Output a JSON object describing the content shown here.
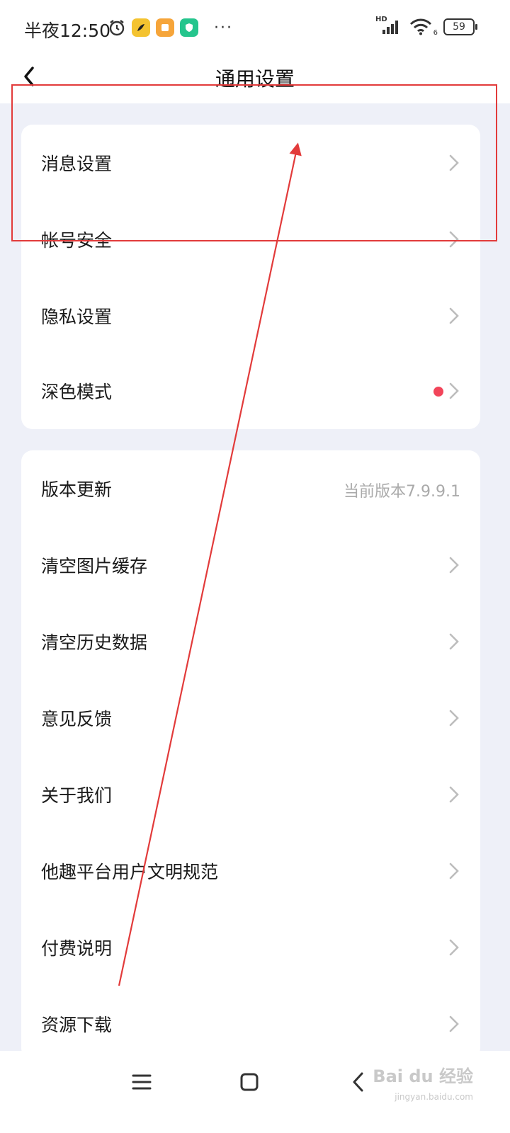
{
  "status_bar": {
    "time": "半夜12:50",
    "more": "···",
    "network": "HD",
    "signal_sub": "6",
    "battery": "59",
    "icons": [
      "alarm-icon",
      "app-yellow-icon",
      "app-orange-icon",
      "app-green-shield-icon",
      "signal-icon",
      "wifi-icon",
      "battery-icon"
    ]
  },
  "header": {
    "title": "通用设置",
    "back_icon": "chevron-left-icon"
  },
  "section1": {
    "items": [
      {
        "label": "消息设置"
      },
      {
        "label": "帐号安全"
      },
      {
        "label": "隐私设置"
      },
      {
        "label": "深色模式",
        "badge": "red-dot"
      }
    ]
  },
  "section2": {
    "items": [
      {
        "label": "版本更新",
        "value": "当前版本7.9.9.1"
      },
      {
        "label": "清空图片缓存"
      },
      {
        "label": "清空历史数据"
      },
      {
        "label": "意见反馈"
      },
      {
        "label": "关于我们"
      },
      {
        "label": "他趣平台用户文明规范"
      },
      {
        "label": "付费说明"
      },
      {
        "label": "资源下载"
      }
    ]
  },
  "nav_bar": {
    "icons": [
      "menu-icon",
      "home-square-icon",
      "back-chevron-icon"
    ]
  },
  "watermark": {
    "text": "Bai du 经验",
    "sub": "jingyan.baidu.com"
  },
  "colors": {
    "background": "#eef0f8",
    "card": "#ffffff",
    "annotation": "#e23b3b",
    "badge_red": "#f2455a",
    "muted_text": "#aaaaaa"
  }
}
